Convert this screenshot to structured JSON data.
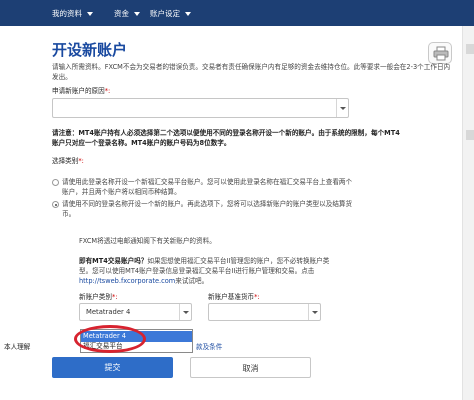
{
  "nav": {
    "items": [
      {
        "label": "我的资料"
      },
      {
        "label": "资金"
      },
      {
        "label": "账户设定"
      }
    ]
  },
  "page": {
    "title": "开设新账户",
    "intro": "请输入所需资料。FXCM不会为交易者的错误负责。交易者有责任确保账户内有足够的资金去维持仓位。此等要求一般会在2-3个工作日内发出。"
  },
  "reason": {
    "label": "申请新账户的原因",
    "required": "*:",
    "value": ""
  },
  "note": "请注意：MT4账户持有人必须选择第二个选项以便使用不同的登录名称开设一个新的账户。由于系统的限制，每个MT4账户只对应一个登录名称。MT4账户的账户号码为8位数字。",
  "select_type": {
    "label": "选择类别",
    "required": "*:",
    "options": [
      {
        "label": "请使用此登录名称开设一个新福汇交易平台账户。您可以使用此登录名称在福汇交易平台上查看两个账户，并且两个账户将以相同币种结算。",
        "selected": false
      },
      {
        "label": "请使用不同的登录名称开设一个新的账户。再此选项下，您将可以选择新账户的账户类型以及结算货币。",
        "selected": true
      }
    ]
  },
  "info": {
    "email_notice": "FXCM将透过电邮通知阁下有关新账户的资料。",
    "mt4_question": "即有MT4交易账户吗？",
    "mt4_body": "如果您想使用福汇交易平台II管理您的账户，您不必转换账户类型。您可以使用MT4账户登录信息登录福汇交易平台II进行账户管理和交易。点击",
    "link": "http://tsweb.fxcorporate.com",
    "link_suffix": "来试试吧。"
  },
  "account_type": {
    "label": "新账户类别",
    "required": "*:",
    "value": "Metatrader 4",
    "dropdown_options": [
      "Metatrader 4",
      "福汇交易平台"
    ]
  },
  "base_currency": {
    "label": "新账户基准货币",
    "required": "*:",
    "value": ""
  },
  "terms": {
    "prefix": "本人理解",
    "link": "款及条件"
  },
  "buttons": {
    "submit": "提交",
    "cancel": "取消"
  },
  "colors": {
    "nav_bg": "#1d3f74",
    "title": "#1a4aa0",
    "primary_button": "#2e6dc8",
    "dropdown_highlight": "#3c78d8",
    "annotation_ring": "#d7232f",
    "required": "#cc0000"
  },
  "icons": {
    "printer": "printer-icon",
    "dropdown": "chevron-down-icon"
  }
}
